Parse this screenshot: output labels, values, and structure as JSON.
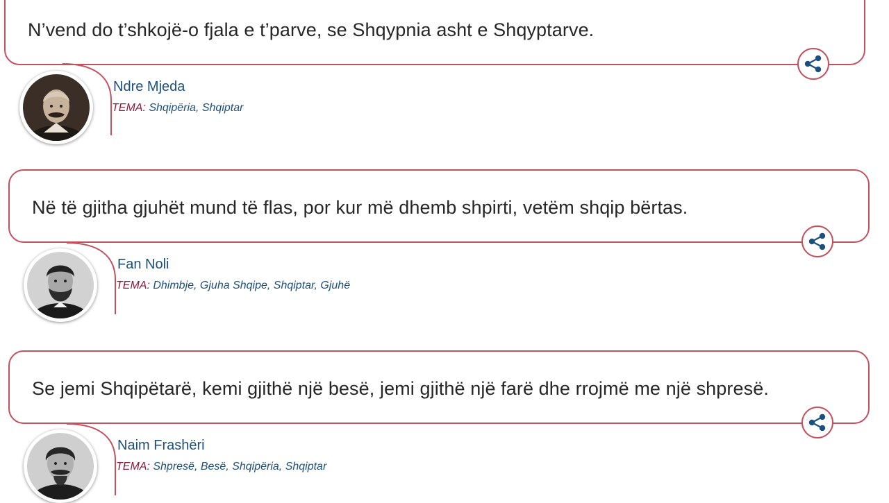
{
  "quotes": [
    {
      "text": "N’vend do t’shkojë-o fjala e t’parve, se Shqypnia asht e Shqyptarve.",
      "author": "Ndre Mjeda",
      "tema_label": "TEMA:",
      "tags": [
        "Shqipëria",
        "Shqiptar"
      ]
    },
    {
      "text": "Në të gjitha gjuhët mund të flas, por kur më dhemb shpirti, vetëm shqip bërtas.",
      "author": "Fan Noli",
      "tema_label": "TEMA:",
      "tags": [
        "Dhimbje",
        "Gjuha Shqipe",
        "Shqiptar",
        "Gjuhë"
      ]
    },
    {
      "text": "Se jemi Shqipëtarë, kemi gjithë një besë, jemi gjithë një farë dhe rrojmë me një shpresë.",
      "author": "Naim Frashëri",
      "tema_label": "TEMA:",
      "tags": [
        "Shpresë",
        "Besë",
        "Shqipëria",
        "Shqiptar"
      ]
    }
  ],
  "icons": {
    "share": "share-icon"
  },
  "colors": {
    "accent": "#c2505d",
    "link": "#1d4f7c",
    "tema": "#8b1a3a",
    "text": "#262626"
  }
}
